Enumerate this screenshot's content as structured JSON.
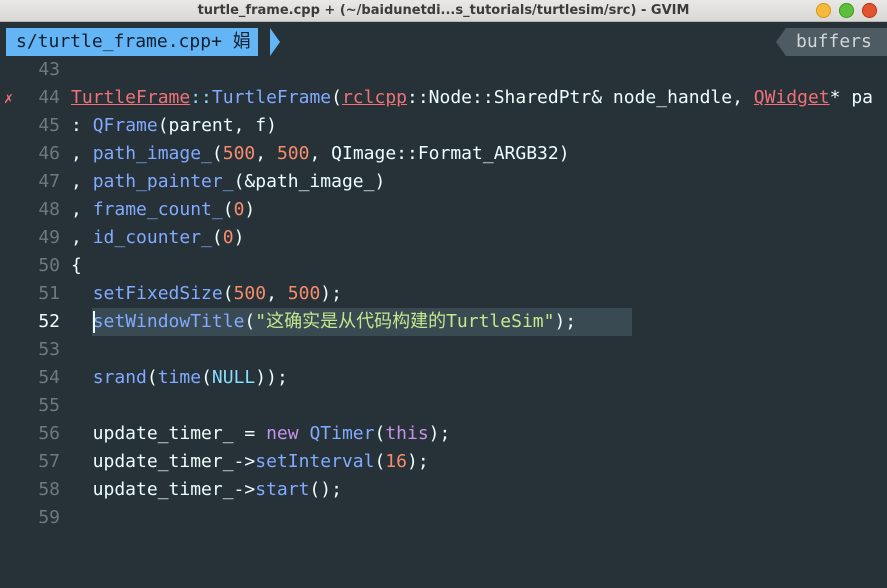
{
  "window": {
    "title": "turtle_frame.cpp + (~/baidunetdi...s_tutorials/turtlesim/src) - GVIM"
  },
  "tabline": {
    "active_tab": "s/turtle_frame.cpp+ 娟",
    "right_label": "buffers"
  },
  "colors": {
    "background": "#263238",
    "tab_active": "#64b5f6",
    "type_red": "#f07178",
    "function_blue": "#82aaff",
    "number_orange": "#f78c6c",
    "keyword_purple": "#c792ea",
    "string_green": "#c3e88d"
  },
  "editor": {
    "current_line": "52",
    "error_sign": "✗",
    "lines": [
      {
        "num": "43"
      },
      {
        "num": "44",
        "t": [
          "TurtleFrame",
          "::",
          "TurtleFrame",
          "(",
          "rclcpp",
          "::Node::SharedPtr& node_handle, ",
          "QWidget",
          "* pa"
        ]
      },
      {
        "num": "45",
        "t": [
          ": ",
          "QFrame",
          "(parent, f)"
        ]
      },
      {
        "num": "46",
        "t": [
          ", ",
          "path_image_",
          "(",
          "500",
          ", ",
          "500",
          ", QImage::Format_ARGB32)"
        ]
      },
      {
        "num": "47",
        "t": [
          ", ",
          "path_painter_",
          "(&path_image_)"
        ]
      },
      {
        "num": "48",
        "t": [
          ", ",
          "frame_count_",
          "(",
          "0",
          ")"
        ]
      },
      {
        "num": "49",
        "t": [
          ", ",
          "id_counter_",
          "(",
          "0",
          ")"
        ]
      },
      {
        "num": "50",
        "t": [
          "{"
        ]
      },
      {
        "num": "51",
        "t": [
          "  ",
          "setFixedSize",
          "(",
          "500",
          ", ",
          "500",
          ");"
        ]
      },
      {
        "num": "52",
        "t": [
          "  ",
          "setWindowTitle",
          "(",
          "\"这确实是从代码构建的TurtleSim\"",
          ");"
        ]
      },
      {
        "num": "53"
      },
      {
        "num": "54",
        "t": [
          "  ",
          "srand",
          "(",
          "time",
          "(",
          "NULL",
          "));"
        ]
      },
      {
        "num": "55"
      },
      {
        "num": "56",
        "t": [
          "  update_timer_ = ",
          "new",
          " ",
          "QTimer",
          "(",
          "this",
          ");"
        ]
      },
      {
        "num": "57",
        "t": [
          "  update_timer_->",
          "setInterval",
          "(",
          "16",
          ");"
        ]
      },
      {
        "num": "58",
        "t": [
          "  update_timer_->",
          "start",
          "();"
        ]
      },
      {
        "num": "59"
      }
    ]
  }
}
